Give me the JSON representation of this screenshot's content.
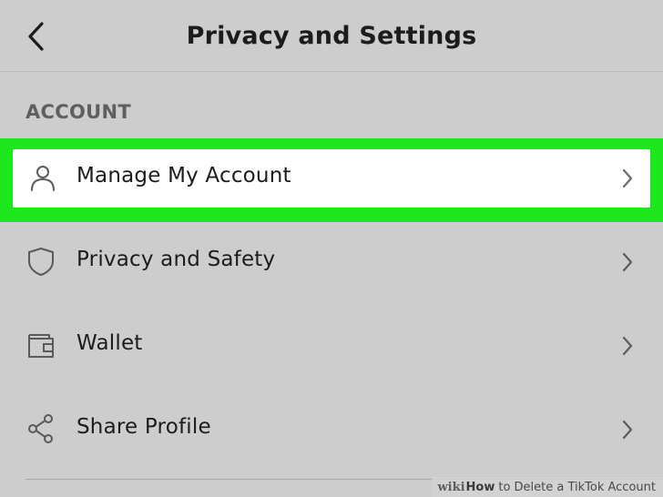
{
  "header": {
    "title": "Privacy and Settings"
  },
  "section": {
    "title": "ACCOUNT"
  },
  "items": [
    {
      "label": "Manage My Account",
      "icon": "person-icon",
      "highlighted": true
    },
    {
      "label": "Privacy and Safety",
      "icon": "shield-icon",
      "highlighted": false
    },
    {
      "label": "Wallet",
      "icon": "wallet-icon",
      "highlighted": false
    },
    {
      "label": "Share Profile",
      "icon": "share-icon",
      "highlighted": false
    }
  ],
  "watermark": {
    "brand": "wiki",
    "bold": "How",
    "text": "to Delete a TikTok Account"
  },
  "colors": {
    "background": "#cdcdcd",
    "highlight": "#1de81d",
    "text": "#1c1c1c",
    "section_text": "#5f5f5f"
  }
}
